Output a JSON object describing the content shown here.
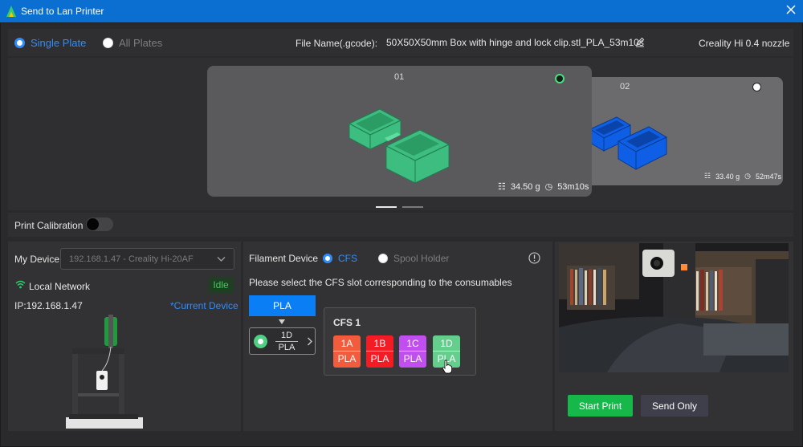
{
  "window": {
    "title": "Send to Lan Printer",
    "accent": "#0a6fd1"
  },
  "plate_mode": {
    "single_label": "Single Plate",
    "all_label": "All Plates",
    "selected": "single"
  },
  "file": {
    "label": "File Name(.gcode):",
    "name": "50X50X50mm Box with hinge and lock clip.stl_PLA_53m10s"
  },
  "printer_profile": "Creality Hi 0.4 nozzle",
  "plates": [
    {
      "id": "01",
      "weight": "34.50 g",
      "time": "53m10s",
      "color": "#3dbd7f",
      "selected": true
    },
    {
      "id": "02",
      "weight": "33.40 g",
      "time": "52m47s",
      "color": "#0f5fe6",
      "selected": false
    }
  ],
  "calibration": {
    "label": "Print Calibration",
    "enabled": false
  },
  "device": {
    "label": "My Device",
    "selected": "192.168.1.47 - Creality Hi-20AF",
    "network_label": "Local Network",
    "status": "Idle",
    "ip": "IP:192.168.1.47",
    "current_label": "*Current Device"
  },
  "filament": {
    "label": "Filament Device",
    "cfs_label": "CFS",
    "spool_label": "Spool Holder",
    "selected_source": "cfs",
    "hint": "Please select the CFS slot corresponding to the consumables",
    "material_button": "PLA",
    "assigned_slot": {
      "id": "1D",
      "material": "PLA",
      "color": "#4fcf83"
    },
    "popup_title": "CFS 1",
    "slots": [
      {
        "id": "1A",
        "material": "PLA",
        "color": "#f25c3d"
      },
      {
        "id": "1B",
        "material": "PLA",
        "color": "#f31c25"
      },
      {
        "id": "1C",
        "material": "PLA",
        "color": "#c14ff0"
      },
      {
        "id": "1D",
        "material": "PLA",
        "color": "#64cf8d"
      }
    ]
  },
  "actions": {
    "start_print": "Start Print",
    "send_only": "Send Only"
  }
}
